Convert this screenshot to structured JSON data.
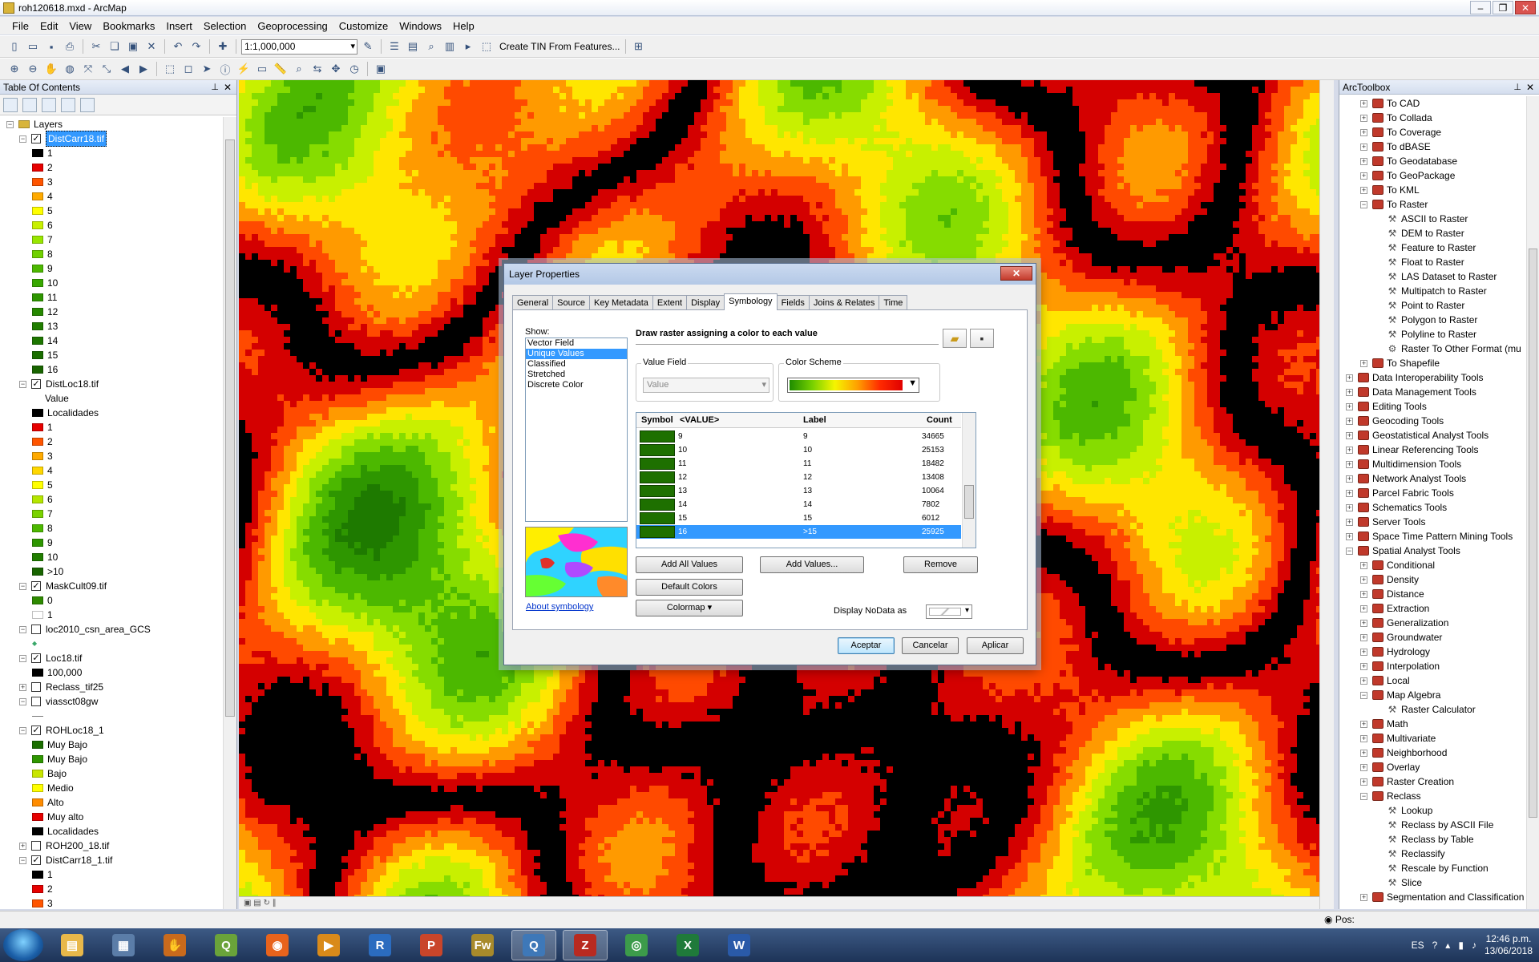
{
  "window": {
    "title": "roh120618.mxd - ArcMap"
  },
  "menu": [
    "File",
    "Edit",
    "View",
    "Bookmarks",
    "Insert",
    "Selection",
    "Geoprocessing",
    "Customize",
    "Windows",
    "Help"
  ],
  "toolbar": {
    "scale": "1:1,000,000",
    "tin_label": "Create TIN From Features..."
  },
  "toc": {
    "title": "Table Of Contents",
    "root": "Layers",
    "rows": [
      {
        "indent": 0,
        "type": "group",
        "label": "Layers"
      },
      {
        "indent": 1,
        "type": "layer",
        "checked": true,
        "label": "DistCarr18.tif",
        "selected": true
      },
      {
        "indent": 2,
        "type": "class",
        "color": "#000000",
        "label": "1"
      },
      {
        "indent": 2,
        "type": "class",
        "color": "#e60000",
        "label": "2"
      },
      {
        "indent": 2,
        "type": "class",
        "color": "#ff5500",
        "label": "3"
      },
      {
        "indent": 2,
        "type": "class",
        "color": "#ffaa00",
        "label": "4"
      },
      {
        "indent": 2,
        "type": "class",
        "color": "#ffff00",
        "label": "5"
      },
      {
        "indent": 2,
        "type": "class",
        "color": "#c8f000",
        "label": "6"
      },
      {
        "indent": 2,
        "type": "class",
        "color": "#98e600",
        "label": "7"
      },
      {
        "indent": 2,
        "type": "class",
        "color": "#70d000",
        "label": "8"
      },
      {
        "indent": 2,
        "type": "class",
        "color": "#4cb800",
        "label": "9"
      },
      {
        "indent": 2,
        "type": "class",
        "color": "#38a800",
        "label": "10"
      },
      {
        "indent": 2,
        "type": "class",
        "color": "#2e9600",
        "label": "11"
      },
      {
        "indent": 2,
        "type": "class",
        "color": "#268800",
        "label": "12"
      },
      {
        "indent": 2,
        "type": "class",
        "color": "#217e00",
        "label": "13"
      },
      {
        "indent": 2,
        "type": "class",
        "color": "#1d7600",
        "label": "14"
      },
      {
        "indent": 2,
        "type": "class",
        "color": "#1a6e00",
        "label": "15"
      },
      {
        "indent": 2,
        "type": "class",
        "color": "#186400",
        "label": "16"
      },
      {
        "indent": 1,
        "type": "layer",
        "checked": true,
        "label": "DistLoc18.tif"
      },
      {
        "indent": 3,
        "type": "text",
        "label": "Value"
      },
      {
        "indent": 2,
        "type": "class",
        "color": "#000000",
        "label": "Localidades"
      },
      {
        "indent": 2,
        "type": "class",
        "color": "#e60000",
        "label": "1"
      },
      {
        "indent": 2,
        "type": "class",
        "color": "#ff5500",
        "label": "2"
      },
      {
        "indent": 2,
        "type": "class",
        "color": "#ffaa00",
        "label": "3"
      },
      {
        "indent": 2,
        "type": "class",
        "color": "#ffd700",
        "label": "4"
      },
      {
        "indent": 2,
        "type": "class",
        "color": "#ffff00",
        "label": "5"
      },
      {
        "indent": 2,
        "type": "class",
        "color": "#b4e600",
        "label": "6"
      },
      {
        "indent": 2,
        "type": "class",
        "color": "#7ad200",
        "label": "7"
      },
      {
        "indent": 2,
        "type": "class",
        "color": "#4cb800",
        "label": "8"
      },
      {
        "indent": 2,
        "type": "class",
        "color": "#2e9600",
        "label": "9"
      },
      {
        "indent": 2,
        "type": "class",
        "color": "#217e00",
        "label": "10"
      },
      {
        "indent": 2,
        "type": "class",
        "color": "#186400",
        "label": ">10"
      },
      {
        "indent": 1,
        "type": "layer",
        "checked": true,
        "label": "MaskCult09.tif"
      },
      {
        "indent": 2,
        "type": "class",
        "color": "#2e8a00",
        "label": "0"
      },
      {
        "indent": 2,
        "type": "class",
        "color": "#ffffff",
        "label": "1"
      },
      {
        "indent": 1,
        "type": "layer",
        "checked": false,
        "label": "loc2010_csn_area_GCS"
      },
      {
        "indent": 2,
        "type": "point",
        "label": ""
      },
      {
        "indent": 1,
        "type": "layer",
        "checked": true,
        "label": "Loc18.tif"
      },
      {
        "indent": 2,
        "type": "class",
        "color": "#000000",
        "label": "100,000"
      },
      {
        "indent": 1,
        "type": "layer-collapsed",
        "checked": false,
        "label": "Reclass_tif25"
      },
      {
        "indent": 1,
        "type": "layer",
        "checked": false,
        "label": "viassct08gw"
      },
      {
        "indent": 2,
        "type": "line",
        "label": ""
      },
      {
        "indent": 1,
        "type": "layer",
        "checked": true,
        "label": "ROHLoc18_1"
      },
      {
        "indent": 2,
        "type": "class",
        "color": "#1a6e00",
        "label": "Muy Bajo"
      },
      {
        "indent": 2,
        "type": "class",
        "color": "#2e9600",
        "label": "Muy Bajo"
      },
      {
        "indent": 2,
        "type": "class",
        "color": "#c8e600",
        "label": "Bajo"
      },
      {
        "indent": 2,
        "type": "class",
        "color": "#ffff00",
        "label": "Medio"
      },
      {
        "indent": 2,
        "type": "class",
        "color": "#ff8c00",
        "label": "Alto"
      },
      {
        "indent": 2,
        "type": "class",
        "color": "#e60000",
        "label": "Muy alto"
      },
      {
        "indent": 2,
        "type": "class",
        "color": "#000000",
        "label": "Localidades"
      },
      {
        "indent": 1,
        "type": "layer-collapsed",
        "checked": false,
        "label": "ROH200_18.tif"
      },
      {
        "indent": 1,
        "type": "layer",
        "checked": true,
        "label": "DistCarr18_1.tif"
      },
      {
        "indent": 2,
        "type": "class",
        "color": "#000000",
        "label": "1"
      },
      {
        "indent": 2,
        "type": "class",
        "color": "#e60000",
        "label": "2"
      },
      {
        "indent": 2,
        "type": "class",
        "color": "#ff5500",
        "label": "3"
      }
    ]
  },
  "toolbox": {
    "title": "ArcToolbox",
    "rows": [
      {
        "indent": 1,
        "kind": "box",
        "exp": "+",
        "label": "To CAD"
      },
      {
        "indent": 1,
        "kind": "box",
        "exp": "+",
        "label": "To Collada"
      },
      {
        "indent": 1,
        "kind": "box",
        "exp": "+",
        "label": "To Coverage"
      },
      {
        "indent": 1,
        "kind": "box",
        "exp": "+",
        "label": "To dBASE"
      },
      {
        "indent": 1,
        "kind": "box",
        "exp": "+",
        "label": "To Geodatabase"
      },
      {
        "indent": 1,
        "kind": "box",
        "exp": "+",
        "label": "To GeoPackage"
      },
      {
        "indent": 1,
        "kind": "box",
        "exp": "+",
        "label": "To KML"
      },
      {
        "indent": 1,
        "kind": "box",
        "exp": "−",
        "label": "To Raster"
      },
      {
        "indent": 2,
        "kind": "tool",
        "label": "ASCII to Raster"
      },
      {
        "indent": 2,
        "kind": "tool",
        "label": "DEM to Raster"
      },
      {
        "indent": 2,
        "kind": "tool",
        "label": "Feature to Raster"
      },
      {
        "indent": 2,
        "kind": "tool",
        "label": "Float to Raster"
      },
      {
        "indent": 2,
        "kind": "tool",
        "label": "LAS Dataset to Raster"
      },
      {
        "indent": 2,
        "kind": "tool",
        "label": "Multipatch to Raster"
      },
      {
        "indent": 2,
        "kind": "tool",
        "label": "Point to Raster"
      },
      {
        "indent": 2,
        "kind": "tool",
        "label": "Polygon to Raster"
      },
      {
        "indent": 2,
        "kind": "tool",
        "label": "Polyline to Raster"
      },
      {
        "indent": 2,
        "kind": "script",
        "label": "Raster To Other Format (mu"
      },
      {
        "indent": 1,
        "kind": "box",
        "exp": "+",
        "label": "To Shapefile"
      },
      {
        "indent": 0,
        "kind": "box",
        "exp": "+",
        "label": "Data Interoperability Tools"
      },
      {
        "indent": 0,
        "kind": "box",
        "exp": "+",
        "label": "Data Management Tools"
      },
      {
        "indent": 0,
        "kind": "box",
        "exp": "+",
        "label": "Editing Tools"
      },
      {
        "indent": 0,
        "kind": "box",
        "exp": "+",
        "label": "Geocoding Tools"
      },
      {
        "indent": 0,
        "kind": "box",
        "exp": "+",
        "label": "Geostatistical Analyst Tools"
      },
      {
        "indent": 0,
        "kind": "box",
        "exp": "+",
        "label": "Linear Referencing Tools"
      },
      {
        "indent": 0,
        "kind": "box",
        "exp": "+",
        "label": "Multidimension Tools"
      },
      {
        "indent": 0,
        "kind": "box",
        "exp": "+",
        "label": "Network Analyst Tools"
      },
      {
        "indent": 0,
        "kind": "box",
        "exp": "+",
        "label": "Parcel Fabric Tools"
      },
      {
        "indent": 0,
        "kind": "box",
        "exp": "+",
        "label": "Schematics Tools"
      },
      {
        "indent": 0,
        "kind": "box",
        "exp": "+",
        "label": "Server Tools"
      },
      {
        "indent": 0,
        "kind": "box",
        "exp": "+",
        "label": "Space Time Pattern Mining Tools"
      },
      {
        "indent": 0,
        "kind": "box",
        "exp": "−",
        "label": "Spatial Analyst Tools"
      },
      {
        "indent": 1,
        "kind": "box",
        "exp": "+",
        "label": "Conditional"
      },
      {
        "indent": 1,
        "kind": "box",
        "exp": "+",
        "label": "Density"
      },
      {
        "indent": 1,
        "kind": "box",
        "exp": "+",
        "label": "Distance"
      },
      {
        "indent": 1,
        "kind": "box",
        "exp": "+",
        "label": "Extraction"
      },
      {
        "indent": 1,
        "kind": "box",
        "exp": "+",
        "label": "Generalization"
      },
      {
        "indent": 1,
        "kind": "box",
        "exp": "+",
        "label": "Groundwater"
      },
      {
        "indent": 1,
        "kind": "box",
        "exp": "+",
        "label": "Hydrology"
      },
      {
        "indent": 1,
        "kind": "box",
        "exp": "+",
        "label": "Interpolation"
      },
      {
        "indent": 1,
        "kind": "box",
        "exp": "+",
        "label": "Local"
      },
      {
        "indent": 1,
        "kind": "box",
        "exp": "−",
        "label": "Map Algebra"
      },
      {
        "indent": 2,
        "kind": "tool",
        "label": "Raster Calculator"
      },
      {
        "indent": 1,
        "kind": "box",
        "exp": "+",
        "label": "Math"
      },
      {
        "indent": 1,
        "kind": "box",
        "exp": "+",
        "label": "Multivariate"
      },
      {
        "indent": 1,
        "kind": "box",
        "exp": "+",
        "label": "Neighborhood"
      },
      {
        "indent": 1,
        "kind": "box",
        "exp": "+",
        "label": "Overlay"
      },
      {
        "indent": 1,
        "kind": "box",
        "exp": "+",
        "label": "Raster Creation"
      },
      {
        "indent": 1,
        "kind": "box",
        "exp": "−",
        "label": "Reclass"
      },
      {
        "indent": 2,
        "kind": "tool",
        "label": "Lookup"
      },
      {
        "indent": 2,
        "kind": "tool",
        "label": "Reclass by ASCII File"
      },
      {
        "indent": 2,
        "kind": "tool",
        "label": "Reclass by Table"
      },
      {
        "indent": 2,
        "kind": "tool",
        "label": "Reclassify"
      },
      {
        "indent": 2,
        "kind": "tool",
        "label": "Rescale by Function"
      },
      {
        "indent": 2,
        "kind": "tool",
        "label": "Slice"
      },
      {
        "indent": 1,
        "kind": "box",
        "exp": "+",
        "label": "Segmentation and Classification"
      }
    ]
  },
  "dialog": {
    "title": "Layer Properties",
    "tabs": [
      "General",
      "Source",
      "Key Metadata",
      "Extent",
      "Display",
      "Symbology",
      "Fields",
      "Joins & Relates",
      "Time"
    ],
    "active_tab": "Symbology",
    "show_label": "Show:",
    "show_items": [
      "Vector Field",
      "Unique Values",
      "Classified",
      "Stretched",
      "Discrete Color"
    ],
    "show_selected": "Unique Values",
    "description": "Draw raster assigning a color to each value",
    "value_field_label": "Value Field",
    "value_field_value": "Value",
    "color_scheme_label": "Color Scheme",
    "table_headers": {
      "symbol": "Symbol",
      "value": "<VALUE>",
      "label": "Label",
      "count": "Count"
    },
    "table_rows": [
      {
        "value": "9",
        "label": "9",
        "count": "34665",
        "selected": false
      },
      {
        "value": "10",
        "label": "10",
        "count": "25153",
        "selected": false
      },
      {
        "value": "11",
        "label": "11",
        "count": "18482",
        "selected": false
      },
      {
        "value": "12",
        "label": "12",
        "count": "13408",
        "selected": false
      },
      {
        "value": "13",
        "label": "13",
        "count": "10064",
        "selected": false
      },
      {
        "value": "14",
        "label": "14",
        "count": "7802",
        "selected": false
      },
      {
        "value": "15",
        "label": "15",
        "count": "6012",
        "selected": false
      },
      {
        "value": "16",
        "label": ">15",
        "count": "25925",
        "selected": true
      }
    ],
    "buttons": {
      "add_all": "Add All Values",
      "add_values": "Add Values...",
      "remove": "Remove",
      "default_colors": "Default Colors",
      "colormap": "Colormap",
      "nodata_label": "Display NoData as",
      "ok": "Aceptar",
      "cancel": "Cancelar",
      "apply": "Aplicar"
    },
    "about_link": "About symbology"
  },
  "status": {
    "pos": "Pos:"
  },
  "taskbar": {
    "lang": "ES",
    "time": "12:46 p.m.",
    "date": "13/06/2018",
    "apps": [
      {
        "name": "explorer",
        "color": "#e8b84a",
        "glyph": "▤"
      },
      {
        "name": "calculator",
        "color": "#5b7da8",
        "glyph": "▦"
      },
      {
        "name": "paw",
        "color": "#c96a1c",
        "glyph": "✋"
      },
      {
        "name": "qgis",
        "color": "#6aa33a",
        "glyph": "Q"
      },
      {
        "name": "firefox",
        "color": "#e8631c",
        "glyph": "◉"
      },
      {
        "name": "media",
        "color": "#d98a1a",
        "glyph": "▶"
      },
      {
        "name": "r",
        "color": "#2b6cbf",
        "glyph": "R"
      },
      {
        "name": "powerpoint",
        "color": "#c9452a",
        "glyph": "P"
      },
      {
        "name": "fireworks",
        "color": "#a88a2b",
        "glyph": "Fw"
      },
      {
        "name": "arcmap",
        "color": "#3e78b8",
        "glyph": "Q",
        "active": true
      },
      {
        "name": "filezilla",
        "color": "#b82a20",
        "glyph": "Z",
        "active": true
      },
      {
        "name": "chrome",
        "color": "#3c9b4a",
        "glyph": "◎"
      },
      {
        "name": "excel",
        "color": "#1f7a3a",
        "glyph": "X"
      },
      {
        "name": "word",
        "color": "#2a5aa8",
        "glyph": "W"
      }
    ]
  }
}
